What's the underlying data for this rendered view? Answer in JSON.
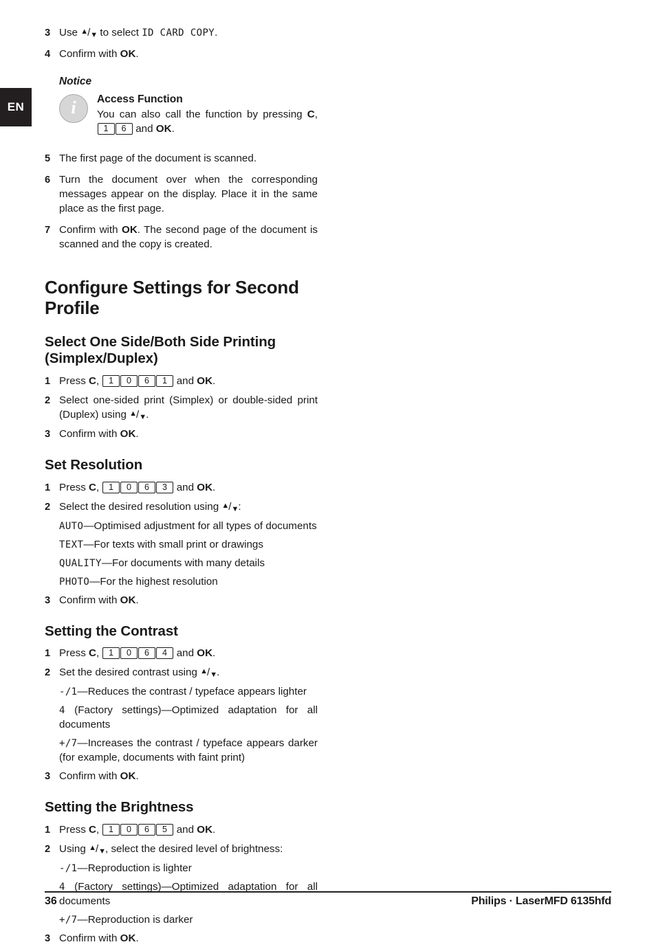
{
  "language_tab": "EN",
  "top_steps": [
    {
      "num": "3",
      "pre": "Use ",
      "arrows": true,
      "mid": " to select ",
      "lcd": "ID CARD COPY",
      "post": "."
    },
    {
      "num": "4",
      "pre": "Confirm with ",
      "bold": "OK",
      "post": "."
    }
  ],
  "notice": {
    "label": "Notice",
    "icon": "info-icon",
    "icon_glyph": "i",
    "title": "Access Function",
    "text_before_keys": "You can also call the function by pressing ",
    "key_c": "C",
    "keys": [
      "1",
      "6"
    ],
    "text_between": ", ",
    "text_and": " and ",
    "key_ok": "OK",
    "text_end": "."
  },
  "post_notice_steps": [
    {
      "num": "5",
      "text": "The first page of the document is scanned."
    },
    {
      "num": "6",
      "text": "Turn the document over when the corresponding messages appear on the display. Place it in the same place as the first page."
    },
    {
      "num": "7",
      "pre": "Confirm with ",
      "bold": "OK",
      "post": ". The second page of the document is scanned and the copy is created."
    }
  ],
  "main_heading": "Configure Settings for Second Profile",
  "sections": [
    {
      "heading": "Select One Side/Both Side Printing (Simplex/Duplex)",
      "key_code": [
        "1",
        "0",
        "6",
        "1"
      ],
      "press_label": "Press ",
      "key_c": "C",
      "and_label": " and ",
      "key_ok": "OK",
      "step1_end": ".",
      "step2": "Select one-sided print (Simplex) or double-sided print (Duplex) using ",
      "step2_end": ".",
      "step3": "Confirm with ",
      "step3_bold": "OK",
      "step3_end": "."
    },
    {
      "heading": "Set Resolution",
      "key_code": [
        "1",
        "0",
        "6",
        "3"
      ],
      "press_label": "Press ",
      "key_c": "C",
      "and_label": " and ",
      "key_ok": "OK",
      "step1_end": ".",
      "step2": "Select the desired resolution using ",
      "step2_end": ":",
      "options": [
        {
          "lcd": "AUTO",
          "dash": "—",
          "desc": "Optimised adjustment for all types of documents"
        },
        {
          "lcd": "TEXT",
          "dash": "—",
          "desc": "For texts with small print or drawings"
        },
        {
          "lcd": "QUALITY",
          "dash": "—",
          "desc": "For documents with many details"
        },
        {
          "lcd": "PHOTO",
          "dash": "—",
          "desc": "For the highest resolution"
        }
      ],
      "step3": "Confirm with ",
      "step3_bold": "OK",
      "step3_end": "."
    },
    {
      "heading": "Setting the Contrast",
      "key_code": [
        "1",
        "0",
        "6",
        "4"
      ],
      "press_label": "Press ",
      "key_c": "C",
      "and_label": " and ",
      "key_ok": "OK",
      "step1_end": ".",
      "step2": "Set the desired contrast using ",
      "step2_end": ".",
      "options": [
        {
          "lcd": "-/1",
          "dash": "—",
          "desc": "Reduces the contrast / typeface appears lighter"
        },
        {
          "lcd": "4",
          "dash": "—",
          "mid": " (Factory settings)",
          "desc": "Optimized adaptation for all documents"
        },
        {
          "lcd": "+/7",
          "dash": "—",
          "desc": "Increases the contrast / typeface appears darker (for example, documents with faint print)"
        }
      ],
      "step3": "Confirm with ",
      "step3_bold": "OK",
      "step3_end": "."
    },
    {
      "heading": "Setting the Brightness",
      "key_code": [
        "1",
        "0",
        "6",
        "5"
      ],
      "press_label": "Press ",
      "key_c": "C",
      "and_label": " and ",
      "key_ok": "OK",
      "step1_end": ".",
      "step2": "Using ",
      "step2_after": ", select the desired level of brightness:",
      "options": [
        {
          "lcd": "-/1",
          "dash": "—",
          "desc": "Reproduction is lighter"
        },
        {
          "lcd": "4",
          "dash": "—",
          "mid": " (Factory settings)",
          "desc": "Optimized adaptation for all documents"
        },
        {
          "lcd": "+/7",
          "dash": "—",
          "desc": "Reproduction is darker"
        }
      ],
      "step3": "Confirm with ",
      "step3_bold": "OK",
      "step3_end": "."
    }
  ],
  "footer": {
    "page_number": "36",
    "imprint": "Philips · LaserMFD 6135hfd"
  },
  "colors": {
    "text": "#1a1a1a",
    "tab_background": "#231f20",
    "tab_text": "#ffffff",
    "icon_fill": "#d6d6d6",
    "icon_border": "#a8a8a8"
  }
}
